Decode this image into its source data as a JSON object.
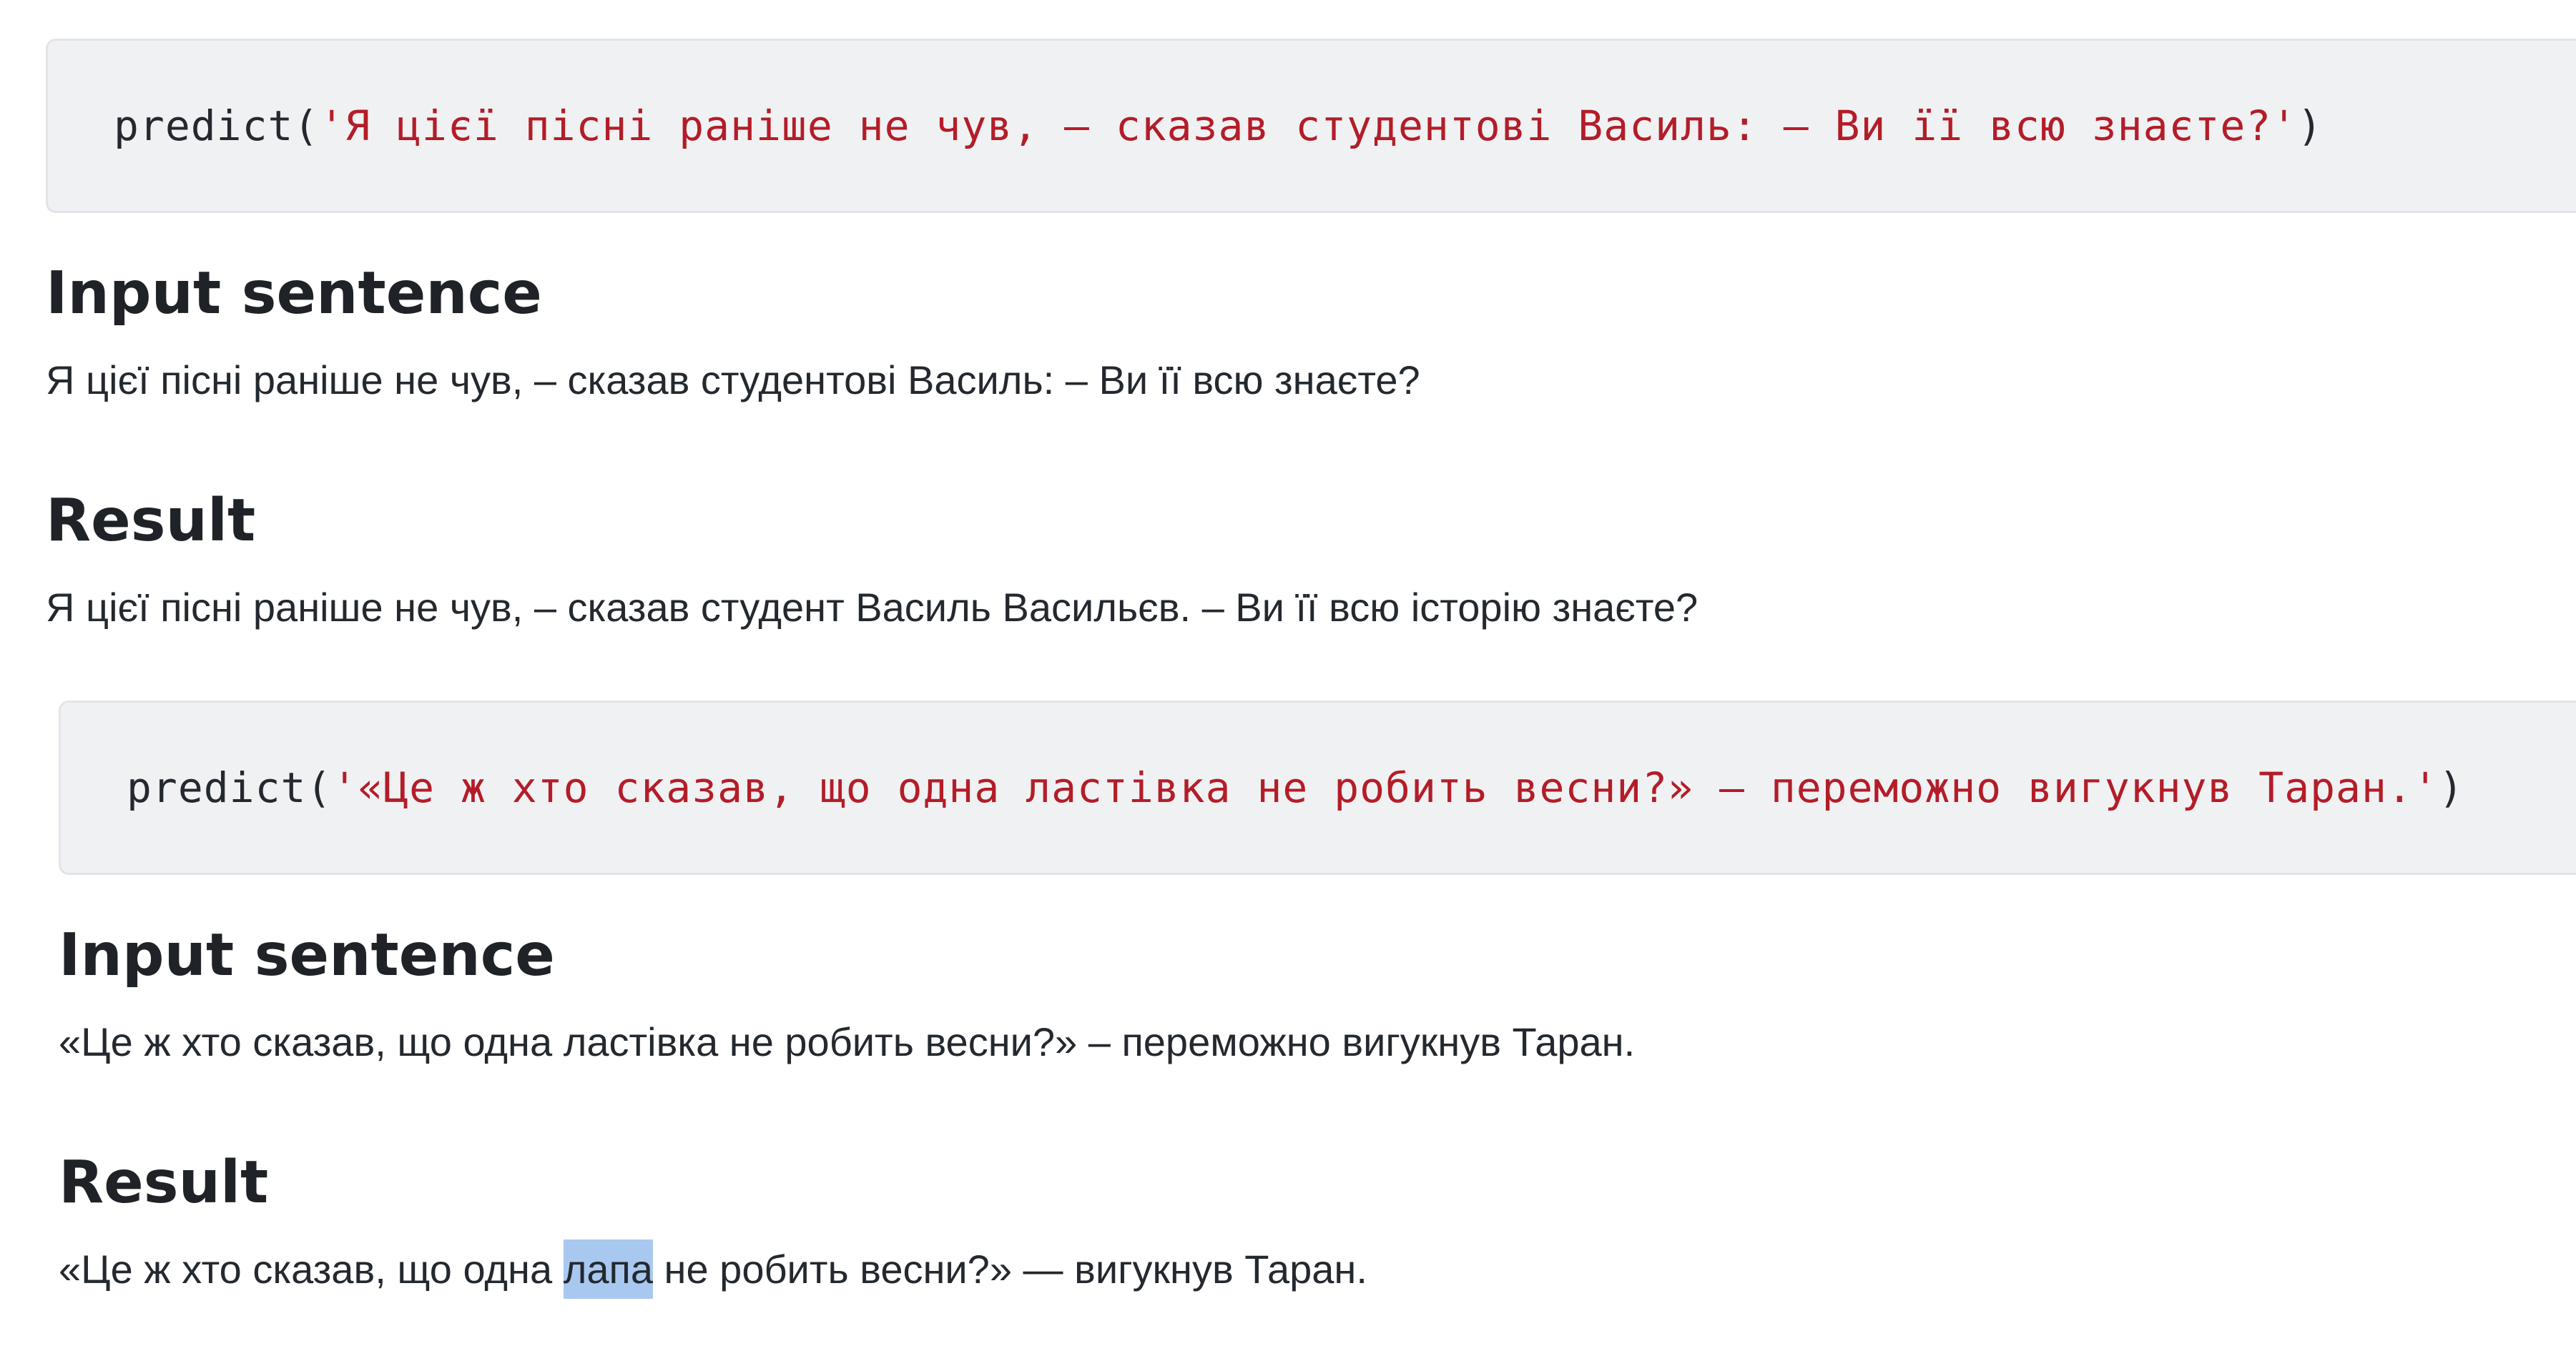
{
  "blocks": [
    {
      "code": {
        "fn": "predict(",
        "arg": "'Я цієї пісні раніше не чув, – сказав студентові Василь: – Ви її всю знаєте?'",
        "close": ")"
      },
      "input_heading": "Input sentence",
      "input_text": "Я цієї пісні раніше не чув, – сказав студентові Василь: – Ви її всю знаєте?",
      "result_heading": "Result",
      "result_text": "Я цієї пісні раніше не чув, – сказав студент Василь Васильєв. – Ви її всю історію знаєте?"
    },
    {
      "code": {
        "fn": "predict(",
        "arg": "'«Це ж хто сказав, що одна ластівка не робить весни?» – переможно вигукнув Таран.'",
        "close": ")"
      },
      "input_heading": "Input sentence",
      "input_text": "«Це ж хто сказав, що одна ластівка не робить весни?» – переможно вигукнув Таран.",
      "result_heading": "Result",
      "result_before": "«Це ж хто сказав, що одна ",
      "result_highlight": "лапа",
      "result_after": " не робить весни?» — вигукнув Таран."
    }
  ]
}
